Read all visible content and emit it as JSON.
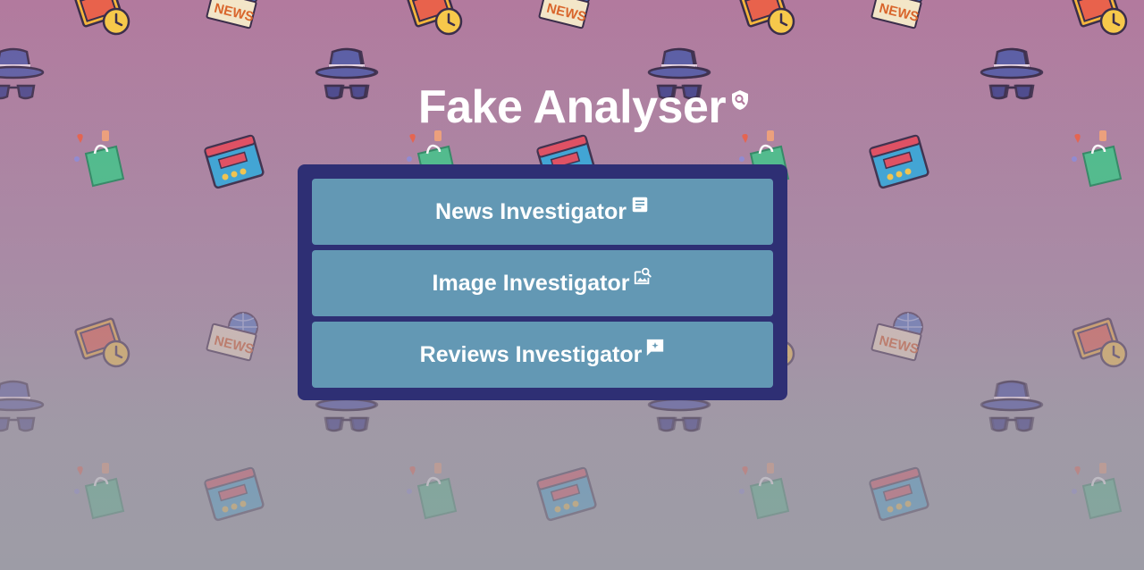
{
  "app": {
    "title": "Fake Analyser",
    "title_icon": "shield-search-icon"
  },
  "menu": {
    "items": [
      {
        "label": "News Investigator",
        "icon": "article-icon"
      },
      {
        "label": "Image Investigator",
        "icon": "image-search-icon"
      },
      {
        "label": "Reviews Investigator",
        "icon": "review-add-icon"
      }
    ]
  },
  "background": {
    "icon_text": "NEWS",
    "icons": [
      "photo-clock-icon",
      "newspaper-globe-icon",
      "detective-hat-glasses-icon",
      "shopping-bag-icon",
      "review-window-icon"
    ]
  },
  "colors": {
    "panel": "#2e2f74",
    "button": "#6398b4",
    "text": "#ffffff"
  }
}
